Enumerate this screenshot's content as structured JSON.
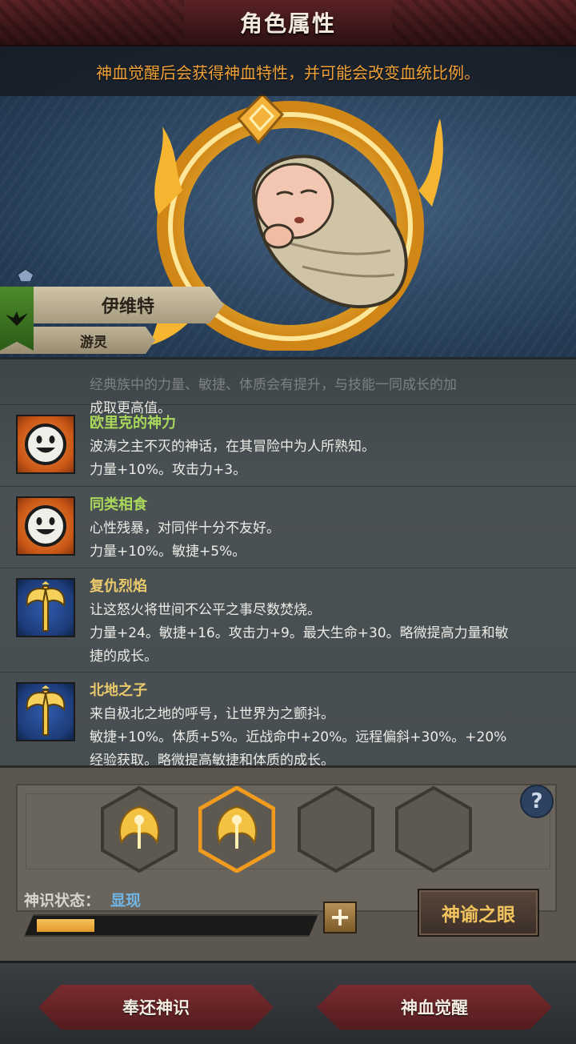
{
  "header": {
    "title": "角色属性"
  },
  "hero": {
    "notice": "神血觉醒后会获得神血特性，并可能会改变血统比例。",
    "character_name": "伊维特",
    "character_class": "游灵"
  },
  "traits": {
    "cut_off_text_line1": "经典族中的力量、敏捷、体质会有提升，与技能一同成长的加",
    "cut_off_text_line2": "成取更高值。",
    "items": [
      {
        "name": "欧里克的神力",
        "line1": "波涛之主不灭的神话，在其冒险中为人所熟知。",
        "line2": "力量+10%。攻击力+3。",
        "line3": "",
        "icon": "smiley-face-icon"
      },
      {
        "name": "同类相食",
        "line1": "心性残暴，对同伴十分不友好。",
        "line2": "力量+10%。敏捷+5%。",
        "line3": "",
        "icon": "smiley-face-icon"
      },
      {
        "name": "复仇烈焰",
        "line1": "让这怒火将世间不公平之事尽数焚烧。",
        "line2": "力量+24。敏捷+16。攻击力+9。最大生命+30。略微提高力量和敏",
        "line3": "捷的成长。",
        "icon": "golden-axe-icon"
      },
      {
        "name": "北地之子",
        "line1": "来自极北之地的呼号，让世界为之颤抖。",
        "line2": "敏捷+10%。体质+5%。近战命中+20%。远程偏斜+30%。+20%",
        "line3": "经验获取。略微提高敏捷和体质的成长。",
        "icon": "golden-axe-icon"
      }
    ]
  },
  "oracle": {
    "status_label": "神识状态：",
    "status_value": "显现",
    "progress": 0.22,
    "help_label": "?",
    "plus_label": "+",
    "eye_button": "神谕之眼",
    "slots": [
      {
        "filled": true,
        "selected": false
      },
      {
        "filled": true,
        "selected": true
      },
      {
        "filled": false,
        "selected": false
      },
      {
        "filled": false,
        "selected": false
      }
    ]
  },
  "footer": {
    "return_button": "奉还神识",
    "awaken_button": "神血觉醒"
  },
  "colors": {
    "accent_orange": "#f1a33a",
    "trait_green": "#a9d85a",
    "trait_gold": "#e9c96c",
    "status_blue": "#71b6e6",
    "button_red": "#7a2b2e"
  }
}
